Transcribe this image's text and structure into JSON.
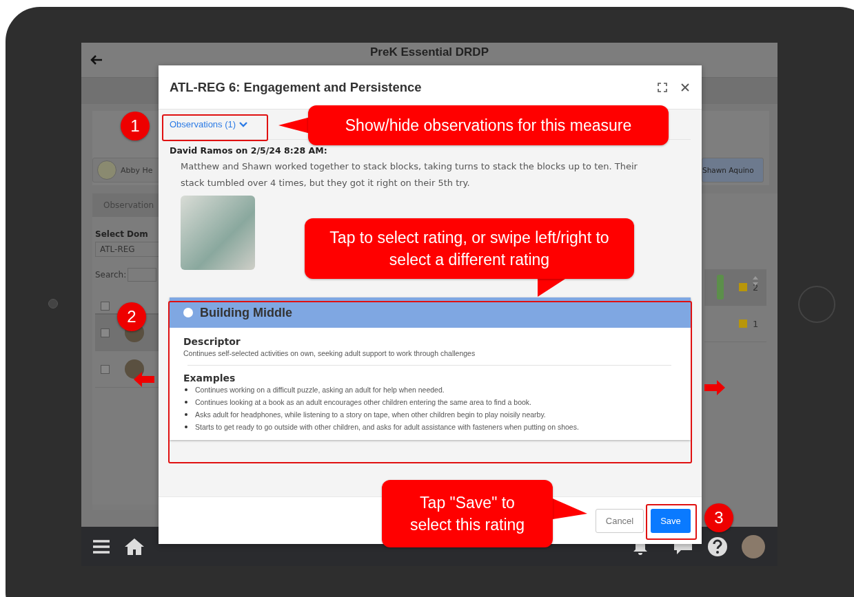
{
  "app": {
    "title": "PreK Essential DRDP",
    "students": [
      {
        "name": "Abby He",
        "selected": false
      },
      {
        "name": "Shawn Aquino",
        "selected": true
      }
    ],
    "tab": "Observation",
    "domain_label": "Select Dom",
    "domain_value": "ATL-REG",
    "search_label": "Search:",
    "select_all_checked": false,
    "rows": [
      {
        "checked": false,
        "count": "2",
        "tagged": true
      },
      {
        "checked": false,
        "count": "1",
        "tagged": false
      }
    ]
  },
  "modal": {
    "title": "ATL-REG 6: Engagement and Persistence",
    "observations_toggle": "Observations (1)",
    "observation": {
      "author_line": "David Ramos on 2/5/24 8:28 AM:",
      "text": "Matthew and Shawn worked together to stack blocks, taking turns to stack the blocks up to ten. Their stack tumbled over 4 times, but they got it right on their 5th try."
    },
    "rating": {
      "name": "Building Middle",
      "selected": false,
      "descriptor_heading": "Descriptor",
      "descriptor": "Continues self-selected activities on own, seeking adult support to work through challenges",
      "examples_heading": "Examples",
      "examples": [
        "Continues working on a difficult puzzle, asking an adult for help when needed.",
        "Continues looking at a book as an adult encourages other children entering the same area to find a book.",
        "Asks adult for headphones, while listening to a story on tape, when other children begin to play noisily nearby.",
        "Starts to get ready to go outside with other children, and asks for adult assistance with fasteners when putting on shoes."
      ]
    },
    "buttons": [
      {
        "label": "Cancel",
        "kind": "secondary"
      },
      {
        "label": "Save",
        "kind": "primary"
      }
    ]
  },
  "annotations": [
    {
      "number": "1",
      "text": "Show/hide observations for this measure"
    },
    {
      "number": "2",
      "text": "Tap to select rating, or swipe left/right to select a different rating"
    },
    {
      "number": "3",
      "text": "Tap \"Save\" to select this rating"
    }
  ]
}
